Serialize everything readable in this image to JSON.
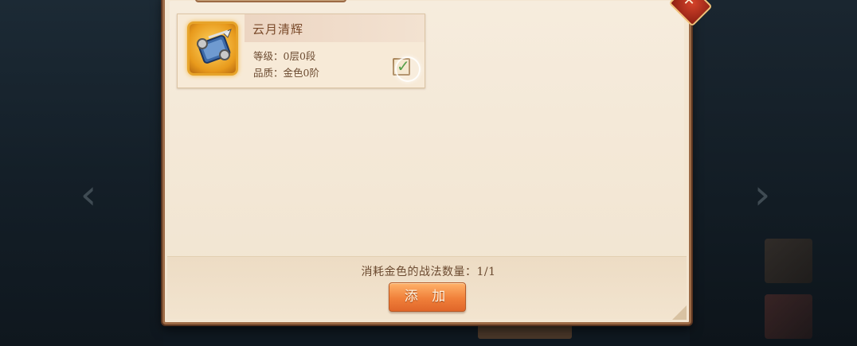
{
  "item": {
    "name": "云月清辉",
    "level": "等级：0层0段",
    "quality": "品质：金色0阶",
    "selected": true,
    "icon": "scroll-artifact-icon",
    "quality_color": "#e89a1c"
  },
  "footer": {
    "consume_text": "消耗金色的战法数量：1/1",
    "add_label": "添 加"
  },
  "colors": {
    "panel_bg": "#f3e6d2",
    "panel_border": "#9c6a45",
    "button_orange": "#f0803a",
    "close_red": "#c2351f"
  },
  "icons": {
    "close": "close-icon",
    "nav_left": "chevron-left-icon",
    "nav_right": "chevron-right-icon",
    "checkmark": "checkmark-icon"
  }
}
